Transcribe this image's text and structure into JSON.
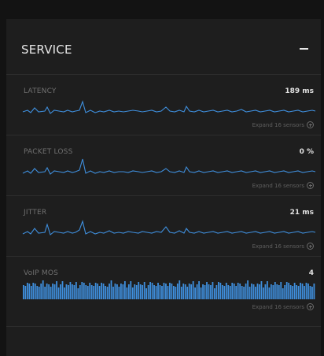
{
  "panel": {
    "title": "SERVICE",
    "collapse_icon": "minus-icon"
  },
  "metrics": [
    {
      "label": "LATENCY",
      "value": "189 ms",
      "expand_label": "Expand 16 sensors",
      "chart_type": "line",
      "color": "#3f8fdd"
    },
    {
      "label": "PACKET LOSS",
      "value": "0 %",
      "expand_label": "Expand 16 sensors",
      "chart_type": "line",
      "color": "#3f8fdd"
    },
    {
      "label": "JITTER",
      "value": "21 ms",
      "expand_label": "Expand 16 sensors",
      "chart_type": "line",
      "color": "#3f8fdd"
    },
    {
      "label": "VoIP MOS",
      "value": "4",
      "expand_label": "Expand 16 sensors",
      "chart_type": "bar",
      "color": "#3f8fdd"
    }
  ]
}
